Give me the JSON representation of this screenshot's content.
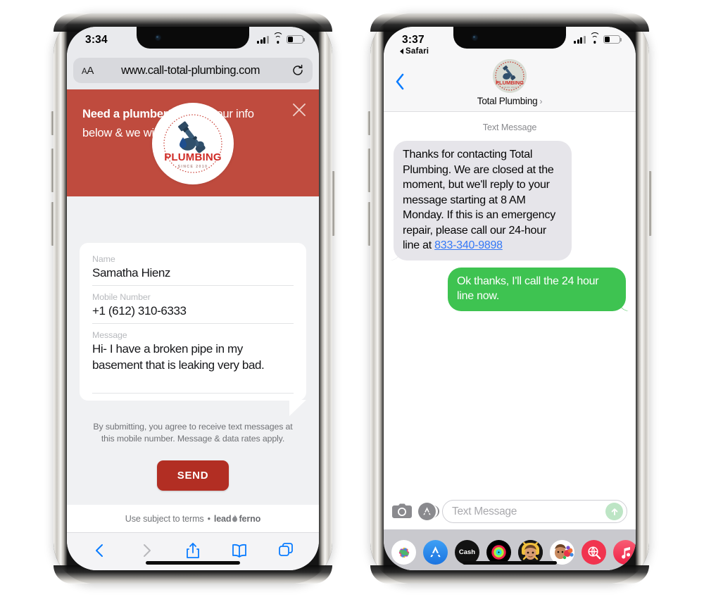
{
  "phone_left": {
    "status_bar": {
      "time": "3:34",
      "signal_icon": "cellular-bars-icon",
      "wifi_icon": "wifi-icon",
      "battery_icon": "battery-icon"
    },
    "browser": {
      "text_size_label": "AA",
      "url": "www.call-total-plumbing.com",
      "reload_icon": "reload-icon",
      "toolbar": {
        "back_icon": "chevron-left-icon",
        "forward_icon": "chevron-right-icon",
        "share_icon": "share-icon",
        "bookmarks_icon": "book-icon",
        "tabs_icon": "tabs-icon"
      }
    },
    "promo": {
      "headline_bold": "Need a plumber?.",
      "headline_rest": " Enter your info below & we will text you back.",
      "close_icon": "close-icon",
      "background_color": "#bf4b3e"
    },
    "logo": {
      "name": "plumbing-logo",
      "brand_text": "PLUMBING",
      "tagline": "SINCE 2010"
    },
    "form": {
      "fields": [
        {
          "label": "Name",
          "value": "Samatha Hienz"
        },
        {
          "label": "Mobile Number",
          "value": "+1 (612) 310-6333"
        },
        {
          "label": "Message",
          "value": "Hi- I have a broken pipe in my basement that is leaking very bad."
        }
      ],
      "disclaimer": "By submitting, you agree to receive text messages at this mobile number. Message & data rates apply.",
      "send_label": "SEND",
      "send_color": "#b22e23"
    },
    "footer": {
      "terms": "Use subject to terms",
      "separator": "•",
      "brand_left": "lead",
      "brand_right": "ferno",
      "flame_icon": "flame-icon"
    }
  },
  "phone_right": {
    "status_bar": {
      "time": "3:37",
      "back_app": "Safari",
      "back_app_icon": "triangle-left-icon",
      "signal_icon": "cellular-bars-icon",
      "wifi_icon": "wifi-icon",
      "battery_icon": "battery-icon"
    },
    "header": {
      "back_icon": "chevron-left-icon",
      "contact_name": "Total Plumbing",
      "chevron_icon": "chevron-right-icon",
      "avatar_icon": "plumbing-avatar"
    },
    "thread": {
      "label": "Text Message",
      "messages": [
        {
          "sender": "them",
          "text_before_link": "Thanks for contacting Total Plumbing. We are closed at the moment, but we'll reply to your message starting at 8 AM Monday. If this is an emergency repair, please call our 24-hour line at ",
          "link_text": "833-340-9898",
          "bubble_color": "#e6e5ea"
        },
        {
          "sender": "me",
          "text_before_link": "Ok thanks, I'll call the 24 hour line now.",
          "link_text": "",
          "bubble_color": "#3ec351"
        }
      ]
    },
    "composer": {
      "camera_icon": "camera-icon",
      "app_store_icon": "app-store-icon",
      "placeholder": "Text Message",
      "send_icon": "send-arrow-icon"
    },
    "dock": {
      "apps": [
        {
          "name": "photos-app-icon",
          "label": "",
          "color": "#ffffff"
        },
        {
          "name": "app-store-app-icon",
          "label": "",
          "color": "#2e8ef0"
        },
        {
          "name": "apple-cash-app-icon",
          "label": "Cash",
          "color": "#111111"
        },
        {
          "name": "fitness-app-icon",
          "label": "",
          "color": "#000000"
        },
        {
          "name": "memoji-app-icon",
          "label": "",
          "color": "#000000"
        },
        {
          "name": "memoji-sticker-app-icon",
          "label": "",
          "color": "#ffffff"
        },
        {
          "name": "images-search-app-icon",
          "label": "",
          "color": "#f1344f"
        },
        {
          "name": "music-app-icon",
          "label": "",
          "color": "#f23b55"
        }
      ]
    }
  }
}
